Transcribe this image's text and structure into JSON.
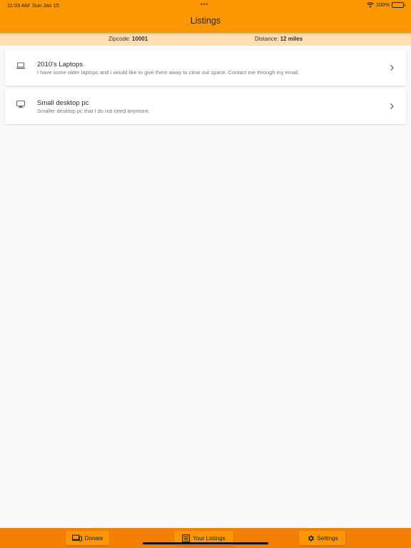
{
  "status_bar": {
    "time": "11:03 AM",
    "date": "Sun Jan 15",
    "battery": "100%",
    "battery_level": 1.0
  },
  "header": {
    "title": "Listings"
  },
  "filters": {
    "zipcode_label": "Zipcode:",
    "zipcode_value": "10001",
    "distance_label": "Distance:",
    "distance_value": "12 miles"
  },
  "listings": [
    {
      "icon": "laptop-icon",
      "title": "2010's Laptops",
      "description": "I have some older laptops and I would like to give them away to clear out space. Contact me through my email."
    },
    {
      "icon": "desktop-icon",
      "title": "Small desktop pc",
      "description": "Smaller desktop pc that I do not need anymore."
    }
  ],
  "bottom_nav": [
    {
      "label": "Donate",
      "icon": "devices-icon"
    },
    {
      "label": "Your Listings",
      "icon": "list-icon"
    },
    {
      "label": "Settings",
      "icon": "gear-icon"
    }
  ],
  "colors": {
    "header": "#fd9701",
    "filter_bar": "#ffdfb1",
    "bottom_bar": "#f57f00",
    "background": "#f9f9f9"
  }
}
